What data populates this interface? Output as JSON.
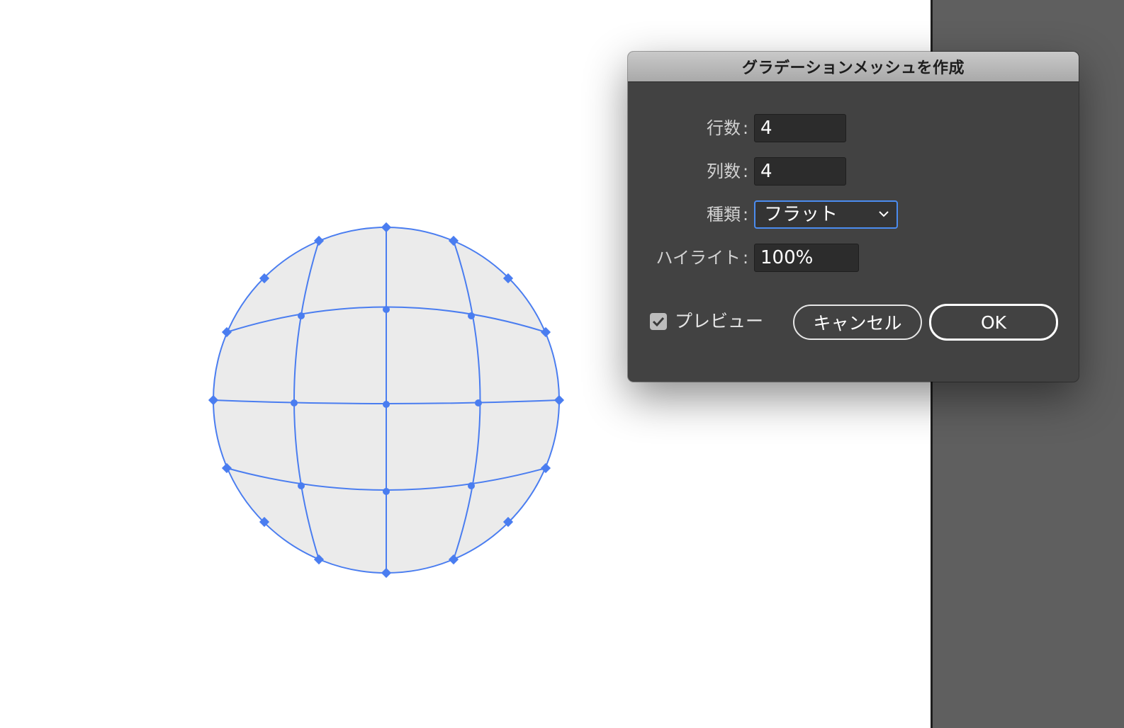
{
  "dialog": {
    "title": "グラデーションメッシュを作成",
    "rows": {
      "label": "行数",
      "value": "4"
    },
    "columns": {
      "label": "列数",
      "value": "4"
    },
    "type": {
      "label": "種類",
      "value": "フラット"
    },
    "highlight": {
      "label": "ハイライト",
      "value": "100%"
    },
    "colon": ":",
    "preview": {
      "label": "プレビュー",
      "checked": true
    },
    "cancel_label": "キャンセル",
    "ok_label": "OK"
  },
  "mesh": {
    "rows": 4,
    "columns": 4,
    "fill_color": "#ebebeb",
    "line_color": "#4a7df0"
  },
  "colors": {
    "pasteboard": "#5f5f5f",
    "dialog_bg": "#424242",
    "accent": "#4b8cf0"
  }
}
